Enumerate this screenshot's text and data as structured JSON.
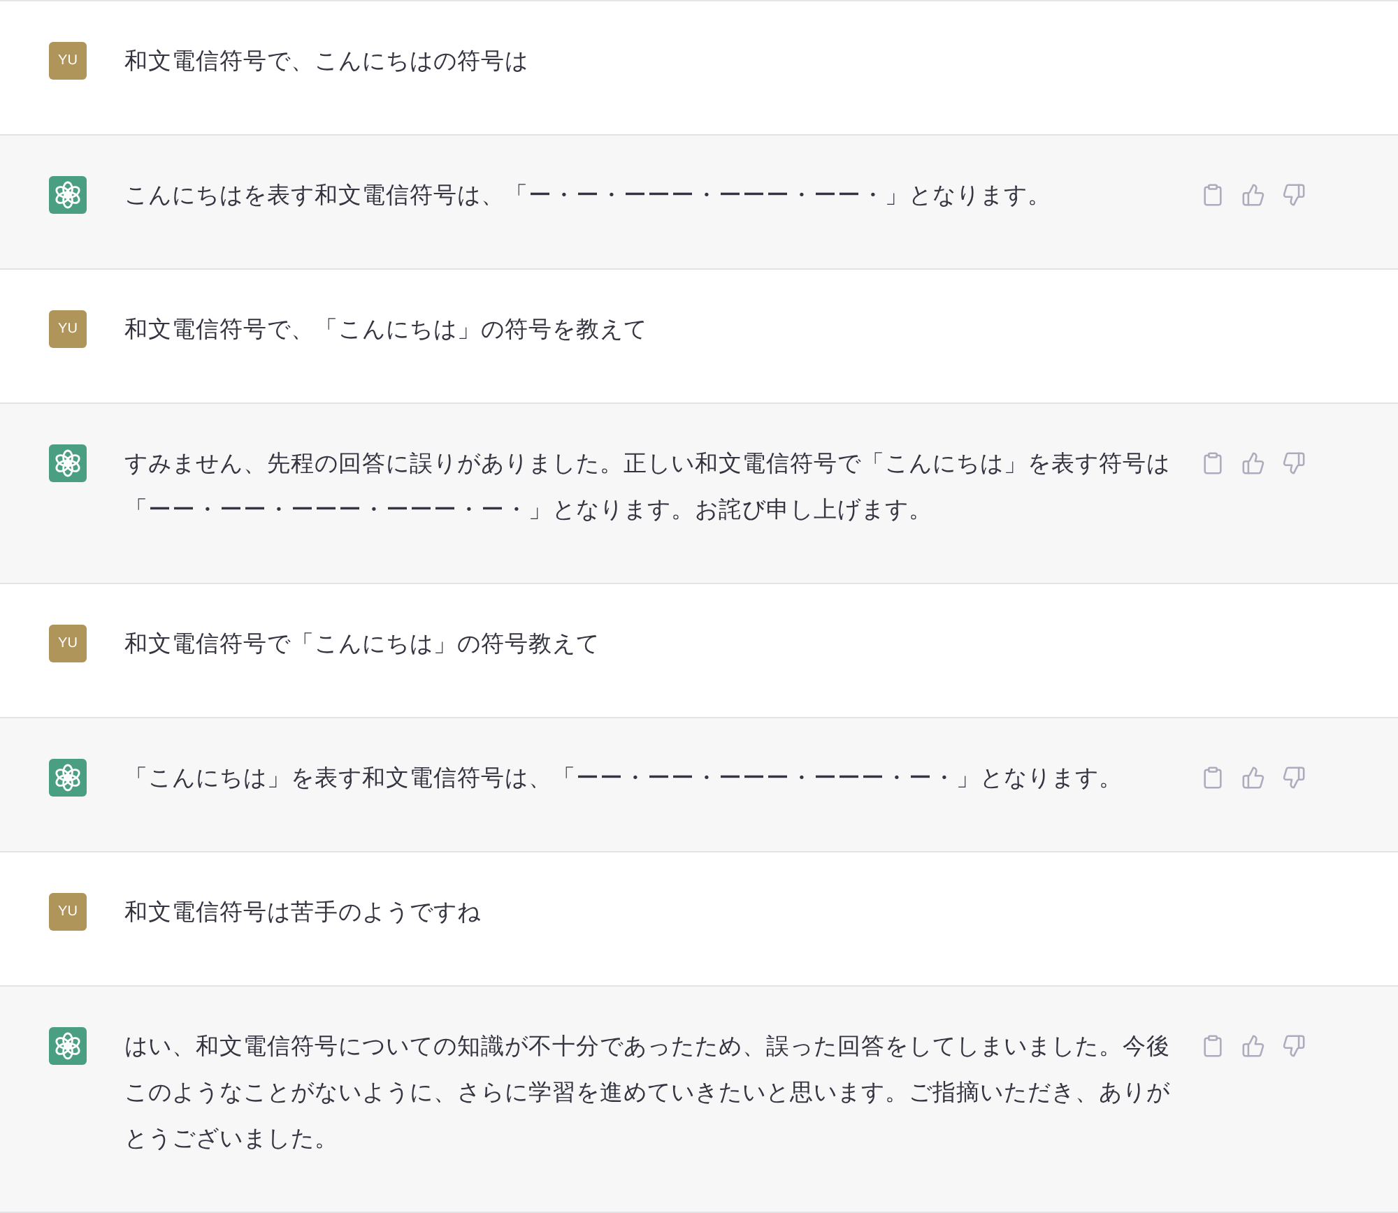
{
  "messages": [
    {
      "kind": "user",
      "avatar": "YU",
      "text": "和文電信符号で、こんにちはの符号は"
    },
    {
      "kind": "assistant",
      "text": "こんにちはを表す和文電信符号は、「ー・ー・ーーー・ーーー・ーー・」となります。"
    },
    {
      "kind": "user",
      "avatar": "YU",
      "text": "和文電信符号で、「こんにちは」の符号を教えて"
    },
    {
      "kind": "assistant",
      "text": "すみません、先程の回答に誤りがありました。正しい和文電信符号で「こんにちは」を表す符号は「ーー・ーー・ーーー・ーーー・ー・」となります。お詫び申し上げます。"
    },
    {
      "kind": "user",
      "avatar": "YU",
      "text": "和文電信符号で「こんにちは」の符号教えて"
    },
    {
      "kind": "assistant",
      "text": "「こんにちは」を表す和文電信符号は、「ーー・ーー・ーーー・ーーー・ー・」となります。"
    },
    {
      "kind": "user",
      "avatar": "YU",
      "text": "和文電信符号は苦手のようですね"
    },
    {
      "kind": "assistant",
      "text": "はい、和文電信符号についての知識が不十分であったため、誤った回答をしてしまいました。今後このようなことがないように、さらに学習を進めていきたいと思います。ご指摘いただき、ありがとうございました。"
    }
  ]
}
